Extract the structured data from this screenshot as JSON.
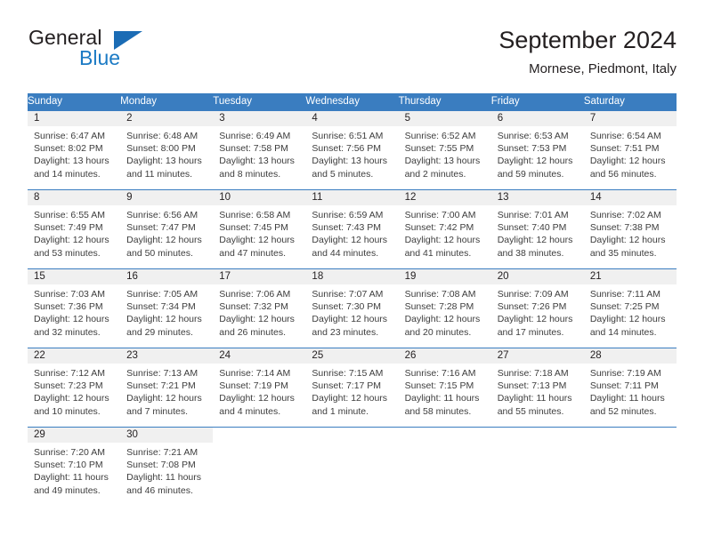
{
  "brand": {
    "name_top": "General",
    "name_bottom": "Blue",
    "triangle_color": "#1b6cb5",
    "blue_text_color": "#1b7ac4"
  },
  "header": {
    "title": "September 2024",
    "subtitle": "Mornese, Piedmont, Italy"
  },
  "theme": {
    "header_blue": "#3a7dc0",
    "daynum_band": "#f0f0f0",
    "text": "#231f20"
  },
  "weekdays": [
    "Sunday",
    "Monday",
    "Tuesday",
    "Wednesday",
    "Thursday",
    "Friday",
    "Saturday"
  ],
  "weeks": [
    [
      {
        "day": "1",
        "sunrise": "Sunrise: 6:47 AM",
        "sunset": "Sunset: 8:02 PM",
        "daylight1": "Daylight: 13 hours",
        "daylight2": "and 14 minutes."
      },
      {
        "day": "2",
        "sunrise": "Sunrise: 6:48 AM",
        "sunset": "Sunset: 8:00 PM",
        "daylight1": "Daylight: 13 hours",
        "daylight2": "and 11 minutes."
      },
      {
        "day": "3",
        "sunrise": "Sunrise: 6:49 AM",
        "sunset": "Sunset: 7:58 PM",
        "daylight1": "Daylight: 13 hours",
        "daylight2": "and 8 minutes."
      },
      {
        "day": "4",
        "sunrise": "Sunrise: 6:51 AM",
        "sunset": "Sunset: 7:56 PM",
        "daylight1": "Daylight: 13 hours",
        "daylight2": "and 5 minutes."
      },
      {
        "day": "5",
        "sunrise": "Sunrise: 6:52 AM",
        "sunset": "Sunset: 7:55 PM",
        "daylight1": "Daylight: 13 hours",
        "daylight2": "and 2 minutes."
      },
      {
        "day": "6",
        "sunrise": "Sunrise: 6:53 AM",
        "sunset": "Sunset: 7:53 PM",
        "daylight1": "Daylight: 12 hours",
        "daylight2": "and 59 minutes."
      },
      {
        "day": "7",
        "sunrise": "Sunrise: 6:54 AM",
        "sunset": "Sunset: 7:51 PM",
        "daylight1": "Daylight: 12 hours",
        "daylight2": "and 56 minutes."
      }
    ],
    [
      {
        "day": "8",
        "sunrise": "Sunrise: 6:55 AM",
        "sunset": "Sunset: 7:49 PM",
        "daylight1": "Daylight: 12 hours",
        "daylight2": "and 53 minutes."
      },
      {
        "day": "9",
        "sunrise": "Sunrise: 6:56 AM",
        "sunset": "Sunset: 7:47 PM",
        "daylight1": "Daylight: 12 hours",
        "daylight2": "and 50 minutes."
      },
      {
        "day": "10",
        "sunrise": "Sunrise: 6:58 AM",
        "sunset": "Sunset: 7:45 PM",
        "daylight1": "Daylight: 12 hours",
        "daylight2": "and 47 minutes."
      },
      {
        "day": "11",
        "sunrise": "Sunrise: 6:59 AM",
        "sunset": "Sunset: 7:43 PM",
        "daylight1": "Daylight: 12 hours",
        "daylight2": "and 44 minutes."
      },
      {
        "day": "12",
        "sunrise": "Sunrise: 7:00 AM",
        "sunset": "Sunset: 7:42 PM",
        "daylight1": "Daylight: 12 hours",
        "daylight2": "and 41 minutes."
      },
      {
        "day": "13",
        "sunrise": "Sunrise: 7:01 AM",
        "sunset": "Sunset: 7:40 PM",
        "daylight1": "Daylight: 12 hours",
        "daylight2": "and 38 minutes."
      },
      {
        "day": "14",
        "sunrise": "Sunrise: 7:02 AM",
        "sunset": "Sunset: 7:38 PM",
        "daylight1": "Daylight: 12 hours",
        "daylight2": "and 35 minutes."
      }
    ],
    [
      {
        "day": "15",
        "sunrise": "Sunrise: 7:03 AM",
        "sunset": "Sunset: 7:36 PM",
        "daylight1": "Daylight: 12 hours",
        "daylight2": "and 32 minutes."
      },
      {
        "day": "16",
        "sunrise": "Sunrise: 7:05 AM",
        "sunset": "Sunset: 7:34 PM",
        "daylight1": "Daylight: 12 hours",
        "daylight2": "and 29 minutes."
      },
      {
        "day": "17",
        "sunrise": "Sunrise: 7:06 AM",
        "sunset": "Sunset: 7:32 PM",
        "daylight1": "Daylight: 12 hours",
        "daylight2": "and 26 minutes."
      },
      {
        "day": "18",
        "sunrise": "Sunrise: 7:07 AM",
        "sunset": "Sunset: 7:30 PM",
        "daylight1": "Daylight: 12 hours",
        "daylight2": "and 23 minutes."
      },
      {
        "day": "19",
        "sunrise": "Sunrise: 7:08 AM",
        "sunset": "Sunset: 7:28 PM",
        "daylight1": "Daylight: 12 hours",
        "daylight2": "and 20 minutes."
      },
      {
        "day": "20",
        "sunrise": "Sunrise: 7:09 AM",
        "sunset": "Sunset: 7:26 PM",
        "daylight1": "Daylight: 12 hours",
        "daylight2": "and 17 minutes."
      },
      {
        "day": "21",
        "sunrise": "Sunrise: 7:11 AM",
        "sunset": "Sunset: 7:25 PM",
        "daylight1": "Daylight: 12 hours",
        "daylight2": "and 14 minutes."
      }
    ],
    [
      {
        "day": "22",
        "sunrise": "Sunrise: 7:12 AM",
        "sunset": "Sunset: 7:23 PM",
        "daylight1": "Daylight: 12 hours",
        "daylight2": "and 10 minutes."
      },
      {
        "day": "23",
        "sunrise": "Sunrise: 7:13 AM",
        "sunset": "Sunset: 7:21 PM",
        "daylight1": "Daylight: 12 hours",
        "daylight2": "and 7 minutes."
      },
      {
        "day": "24",
        "sunrise": "Sunrise: 7:14 AM",
        "sunset": "Sunset: 7:19 PM",
        "daylight1": "Daylight: 12 hours",
        "daylight2": "and 4 minutes."
      },
      {
        "day": "25",
        "sunrise": "Sunrise: 7:15 AM",
        "sunset": "Sunset: 7:17 PM",
        "daylight1": "Daylight: 12 hours",
        "daylight2": "and 1 minute."
      },
      {
        "day": "26",
        "sunrise": "Sunrise: 7:16 AM",
        "sunset": "Sunset: 7:15 PM",
        "daylight1": "Daylight: 11 hours",
        "daylight2": "and 58 minutes."
      },
      {
        "day": "27",
        "sunrise": "Sunrise: 7:18 AM",
        "sunset": "Sunset: 7:13 PM",
        "daylight1": "Daylight: 11 hours",
        "daylight2": "and 55 minutes."
      },
      {
        "day": "28",
        "sunrise": "Sunrise: 7:19 AM",
        "sunset": "Sunset: 7:11 PM",
        "daylight1": "Daylight: 11 hours",
        "daylight2": "and 52 minutes."
      }
    ],
    [
      {
        "day": "29",
        "sunrise": "Sunrise: 7:20 AM",
        "sunset": "Sunset: 7:10 PM",
        "daylight1": "Daylight: 11 hours",
        "daylight2": "and 49 minutes."
      },
      {
        "day": "30",
        "sunrise": "Sunrise: 7:21 AM",
        "sunset": "Sunset: 7:08 PM",
        "daylight1": "Daylight: 11 hours",
        "daylight2": "and 46 minutes."
      },
      {
        "day": "",
        "sunrise": "",
        "sunset": "",
        "daylight1": "",
        "daylight2": ""
      },
      {
        "day": "",
        "sunrise": "",
        "sunset": "",
        "daylight1": "",
        "daylight2": ""
      },
      {
        "day": "",
        "sunrise": "",
        "sunset": "",
        "daylight1": "",
        "daylight2": ""
      },
      {
        "day": "",
        "sunrise": "",
        "sunset": "",
        "daylight1": "",
        "daylight2": ""
      },
      {
        "day": "",
        "sunrise": "",
        "sunset": "",
        "daylight1": "",
        "daylight2": ""
      }
    ]
  ]
}
